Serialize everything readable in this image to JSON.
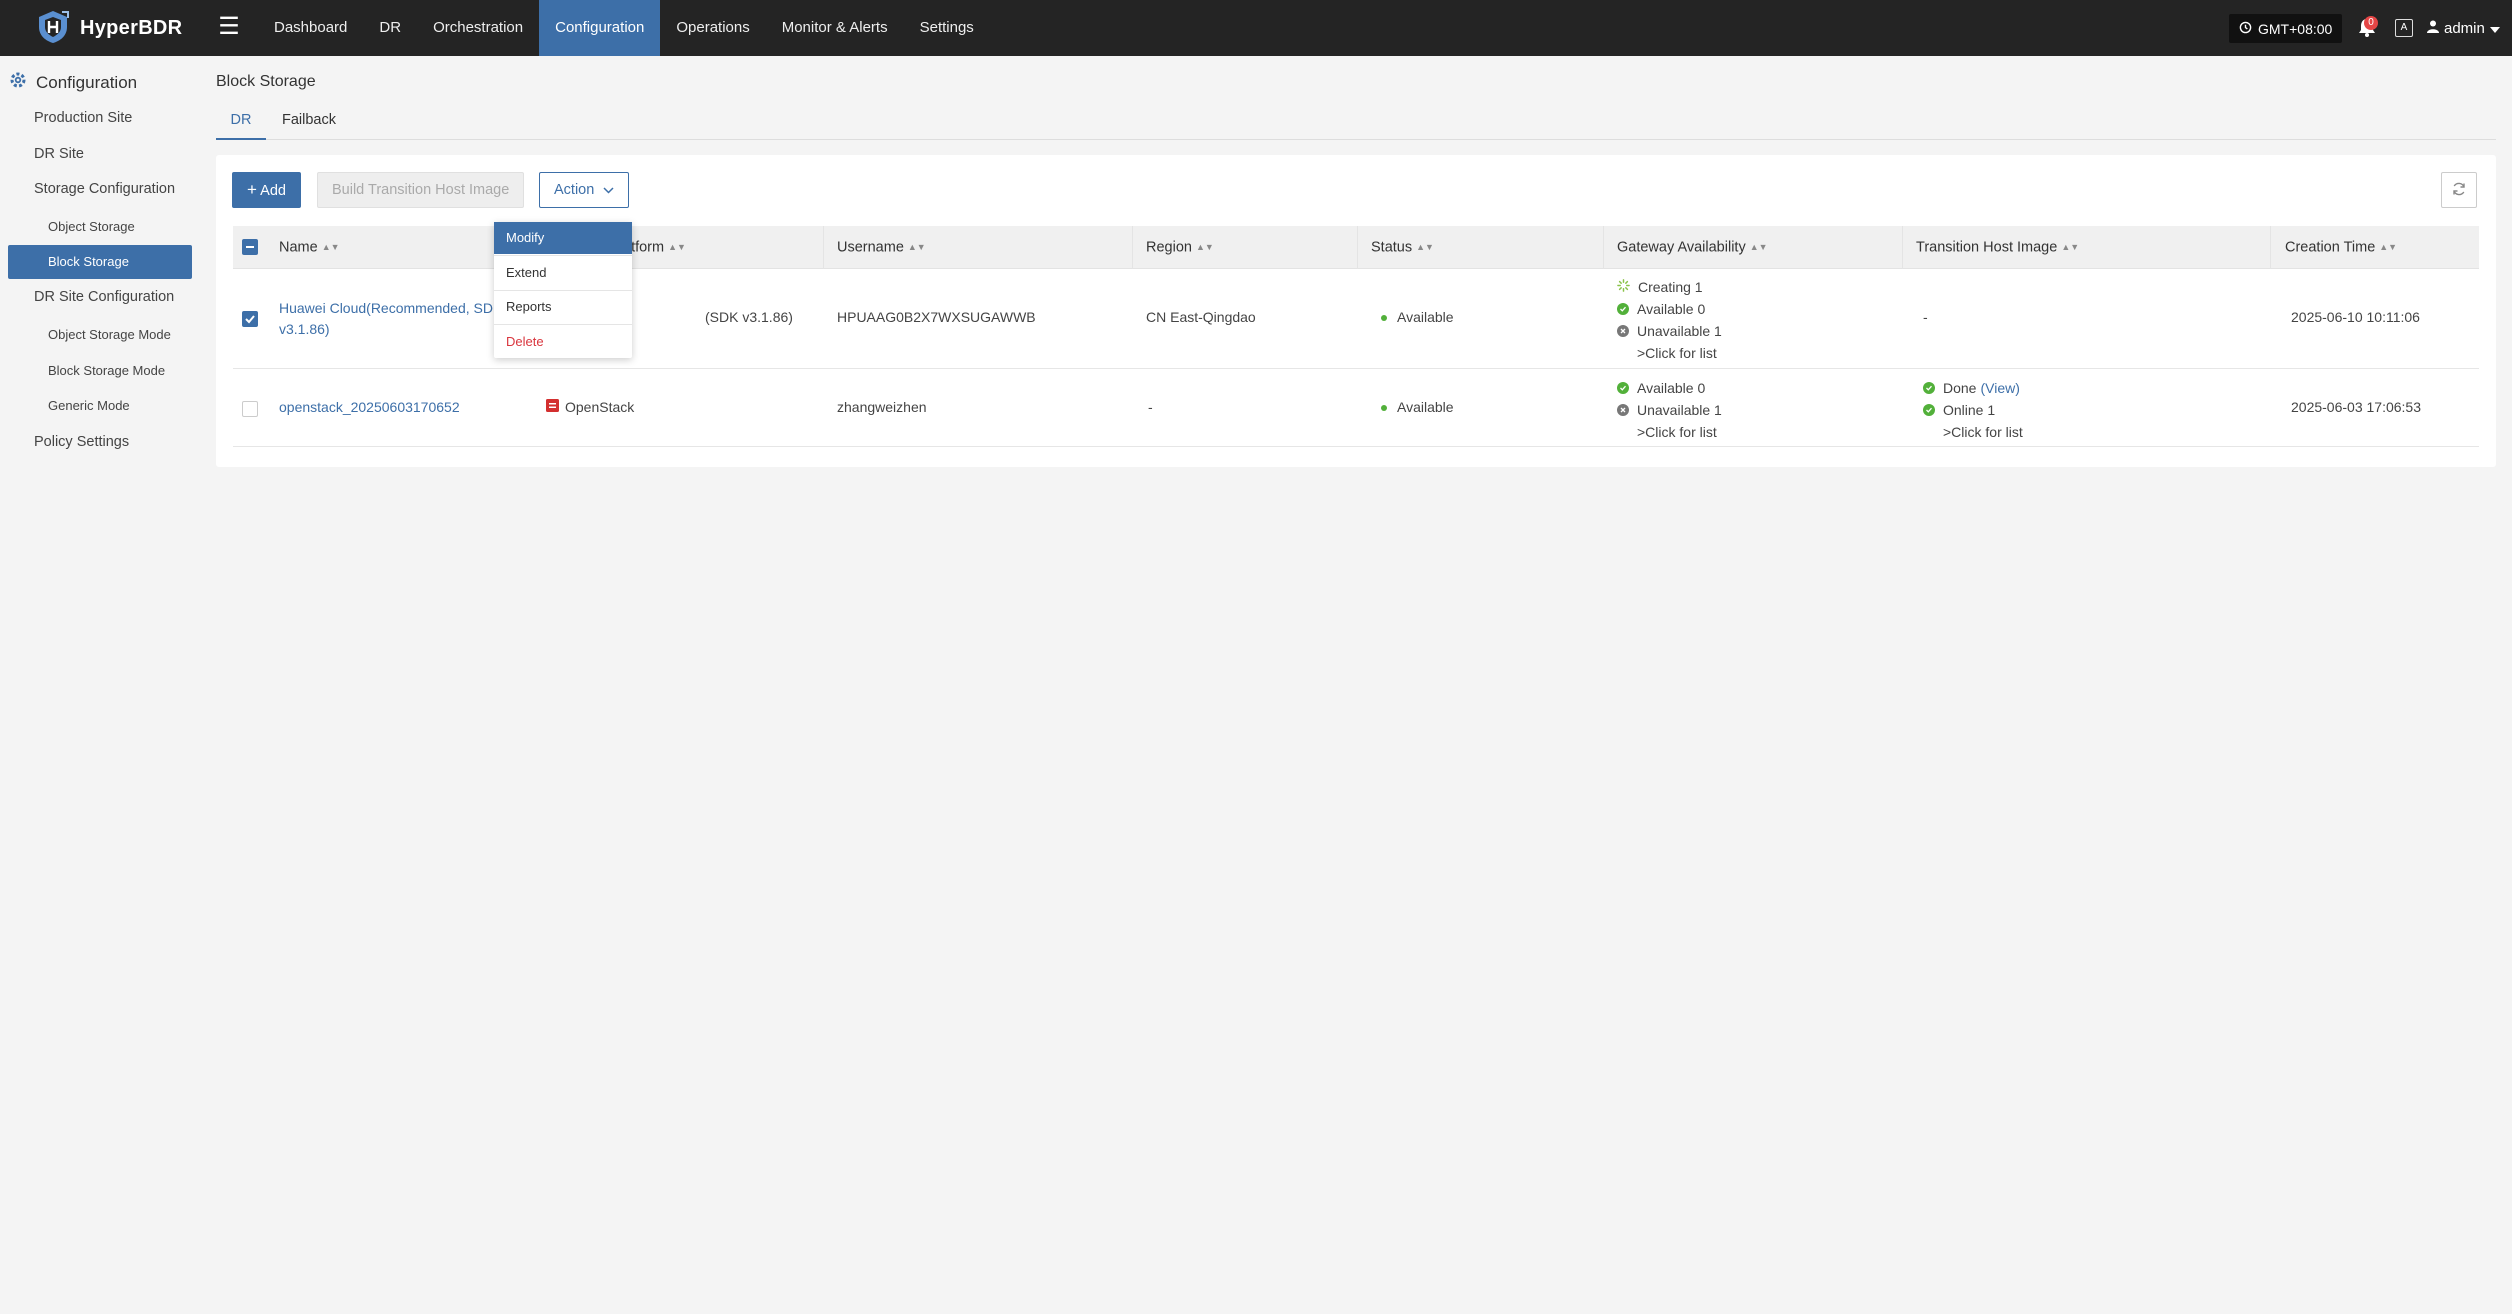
{
  "app": {
    "name": "HyperBDR"
  },
  "nav": {
    "items": [
      "Dashboard",
      "DR",
      "Orchestration",
      "Configuration",
      "Operations",
      "Monitor & Alerts",
      "Settings"
    ],
    "active": "Configuration"
  },
  "header": {
    "timezone": "GMT+08:00",
    "notification_count": "0",
    "lang_icon": "A",
    "user": "admin"
  },
  "sidebar": {
    "root": "Configuration",
    "items": {
      "production_site": "Production Site",
      "dr_site": "DR Site",
      "storage_configuration": "Storage Configuration",
      "object_storage": "Object Storage",
      "block_storage": "Block Storage",
      "dr_site_configuration": "DR Site Configuration",
      "object_storage_mode": "Object Storage Mode",
      "block_storage_mode": "Block Storage Mode",
      "generic_mode": "Generic Mode",
      "policy_settings": "Policy Settings"
    }
  },
  "page": {
    "title": "Block Storage",
    "tabs": {
      "dr": "DR",
      "failback": "Failback"
    },
    "active_tab": "DR"
  },
  "toolbar": {
    "add": "Add",
    "build_image": "Build Transition Host Image",
    "action": "Action"
  },
  "table": {
    "columns": {
      "name": "Name",
      "platform": "atform",
      "username": "Username",
      "region": "Region",
      "status": "Status",
      "gateway": "Gateway Availability",
      "transition": "Transition Host Image",
      "creation": "Creation Time"
    },
    "rows": [
      {
        "checked": true,
        "name_line1": "Huawei Cloud(Recommended, SDK",
        "name_line2": "v3.1.86)",
        "platform": "(SDK v3.1.86)",
        "username": "HPUAAG0B2X7WXSUGAWWB",
        "region": "CN East-Qingdao",
        "status": "Available",
        "gateway": {
          "creating": "Creating 1",
          "available": "Available 0",
          "unavailable": "Unavailable 1",
          "link": ">Click for list"
        },
        "transition": "-",
        "creation_time": "2025-06-10 10:11:06"
      },
      {
        "checked": false,
        "name": "openstack_20250603170652",
        "platform": "OpenStack",
        "username": "zhangweizhen",
        "region": "-",
        "status": "Available",
        "gateway": {
          "available": "Available 0",
          "unavailable": "Unavailable 1",
          "link": ">Click for list"
        },
        "transition": {
          "done": "Done",
          "view": "(View)",
          "online": "Online 1",
          "link": ">Click for list"
        },
        "creation_time": "2025-06-03 17:06:53"
      }
    ]
  },
  "action_menu": {
    "modify": "Modify",
    "extend": "Extend",
    "reports": "Reports",
    "delete": "Delete"
  },
  "colors": {
    "topbar": "#242424",
    "accent": "#3d6fa8",
    "success": "#52b03a",
    "danger": "#d9363e"
  }
}
